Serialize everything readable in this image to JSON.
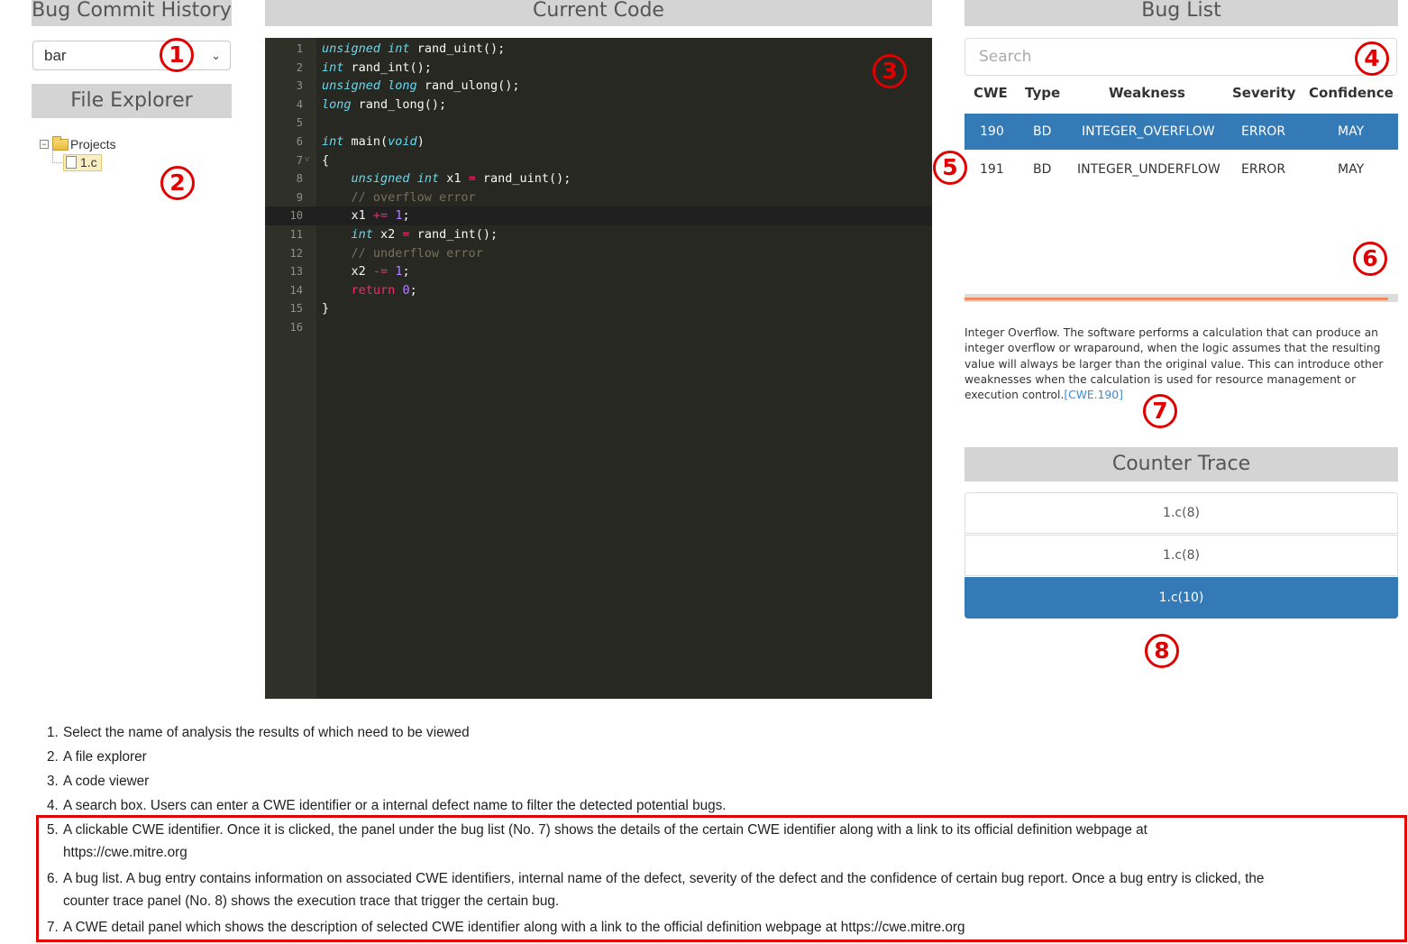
{
  "headers": {
    "bug_commit_history": "Bug Commit History",
    "file_explorer": "File Explorer",
    "current_code": "Current Code",
    "bug_list": "Bug List",
    "counter_trace": "Counter Trace"
  },
  "commit_select": {
    "value": "bar"
  },
  "file_tree": {
    "root": "Projects",
    "file": "1.c"
  },
  "code_lines": [
    "unsigned int rand_uint();",
    "int rand_int();",
    "unsigned long rand_ulong();",
    "long rand_long();",
    "",
    "int main(void)",
    "{",
    "    unsigned int x1 = rand_uint();",
    "    // overflow error",
    "    x1 += 1;",
    "    int x2 = rand_int();",
    "    // underflow error",
    "    x2 -= 1;",
    "    return 0;",
    "}",
    ""
  ],
  "active_line": 10,
  "search": {
    "placeholder": "Search"
  },
  "bug_table": {
    "columns": [
      "CWE",
      "Type",
      "Weakness",
      "Severity",
      "Confidence"
    ],
    "rows": [
      {
        "cwe": "190",
        "type": "BD",
        "weakness": "INTEGER_OVERFLOW",
        "severity": "ERROR",
        "confidence": "MAY",
        "selected": true
      },
      {
        "cwe": "191",
        "type": "BD",
        "weakness": "INTEGER_UNDERFLOW",
        "severity": "ERROR",
        "confidence": "MAY",
        "selected": false
      }
    ]
  },
  "cwe_detail": {
    "text": "Integer Overflow. The software performs a calculation that can produce an integer overflow or wraparound, when the logic assumes that the resulting value will always be larger than the original value. This can introduce other weaknesses when the calculation is used for resource management or execution control.",
    "link": "[CWE.190]"
  },
  "counter_trace": [
    "1.c(8)",
    "1.c(8)",
    "1.c(10)"
  ],
  "markers": [
    "1",
    "2",
    "3",
    "4",
    "5",
    "6",
    "7",
    "8"
  ],
  "notes": [
    {
      "idx": "1.",
      "text": "Select the name of analysis the results of which need to be viewed"
    },
    {
      "idx": "2.",
      "text": "A file explorer"
    },
    {
      "idx": "3.",
      "text": "A code viewer"
    },
    {
      "idx": "4.",
      "text": "A search box. Users can enter a CWE identifier or a internal defect name to filter the detected potential bugs."
    },
    {
      "idx": "5.",
      "text": "A clickable CWE identifier. Once it is clicked, the panel under the bug list (No. 7) shows the details of the certain CWE identifier along with a link to its official definition webpage at",
      "cont": "https://cwe.mitre.org"
    },
    {
      "idx": "6.",
      "text": "A bug list. A bug entry contains information on associated CWE identifiers, internal name of the defect, severity of the defect and the confidence of certain bug report. Once a bug entry is clicked, the",
      "cont": "counter trace panel (No. 8) shows the execution trace that trigger the certain bug."
    },
    {
      "idx": "7.",
      "text": "A CWE detail panel which shows the description of selected CWE identifier along with a link to the official definition webpage at https://cwe.mitre.org"
    }
  ],
  "colors": {
    "accent": "#337ab7",
    "marker": "#e00000",
    "editor_bg": "#272822"
  }
}
